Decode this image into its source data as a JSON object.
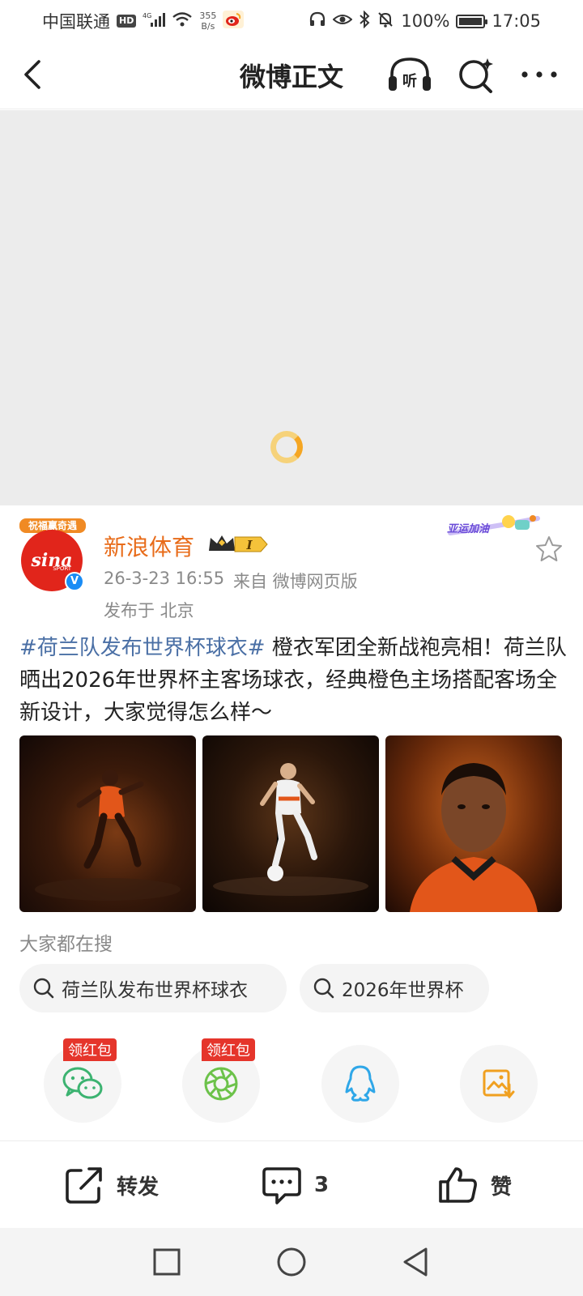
{
  "status_bar": {
    "carrier": "中国联通",
    "hd": "HD",
    "net_type": "4G",
    "net_speed_value": "355",
    "net_speed_unit": "B/s",
    "battery": "100%",
    "time": "17:05"
  },
  "nav": {
    "title": "微博正文",
    "listen_label": "听"
  },
  "post": {
    "author": "新浪体育",
    "avatar_text": "sina",
    "avatar_sub": "SPORT",
    "avatar_ribbon": "祝福赢奇遇",
    "member_level": "I",
    "campaign_badge": "亚运加油",
    "time": "26-3-23 16:55",
    "source": "来自 微博网页版",
    "location": "发布于 北京",
    "hashtag": "#荷兰队发布世界杯球衣#",
    "body": " 橙衣军团全新战袍亮相！荷兰队晒出2026年世界杯主客场球衣，经典橙色主场搭配客场全新设计，大家觉得怎么样～",
    "photos": [
      "photo-1",
      "photo-2",
      "photo-3"
    ]
  },
  "search": {
    "section_label": "大家都在搜",
    "chips": [
      "荷兰队发布世界杯球衣",
      "2026年世界杯"
    ]
  },
  "share": {
    "items": [
      {
        "icon": "wechat-icon",
        "tag": "领红包"
      },
      {
        "icon": "moments-icon",
        "tag": "领红包"
      },
      {
        "icon": "qq-icon",
        "tag": ""
      },
      {
        "icon": "save-image-icon",
        "tag": ""
      }
    ],
    "colors": {
      "wechat": "#3cb371",
      "moments": "#6cc24a",
      "qq": "#2fa7e8",
      "save": "#f0a020"
    }
  },
  "actions": {
    "repost": "转发",
    "comment_count": "3",
    "like": "赞"
  },
  "colors": {
    "author": "#e86c1a",
    "hashtag": "#4a6fa5",
    "meta": "#8a8a8a",
    "tag_red": "#e5352b"
  }
}
